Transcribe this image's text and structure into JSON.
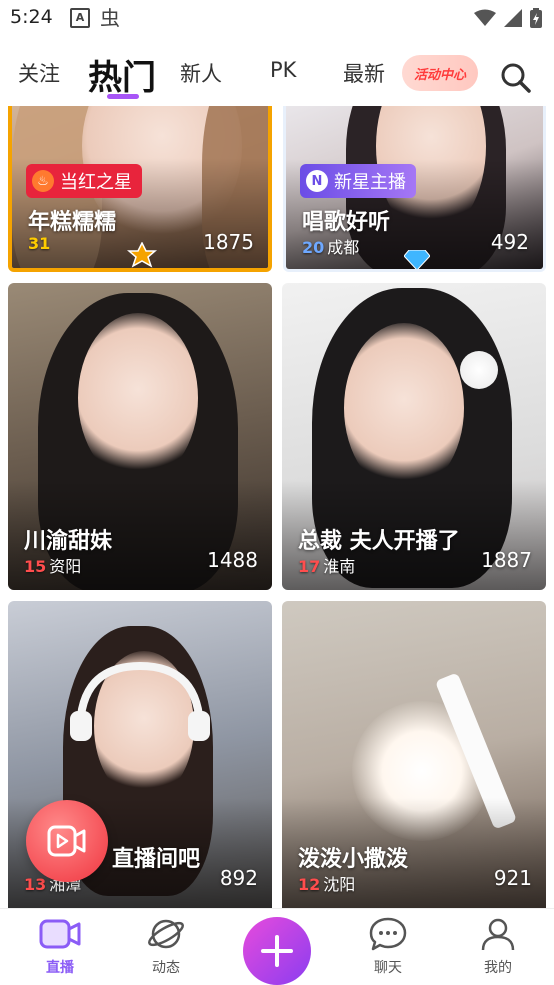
{
  "status_bar": {
    "time": "5:24",
    "icons": [
      "a-icon",
      "bug-icon",
      "wifi-icon",
      "signal-icon",
      "battery-icon"
    ]
  },
  "tabs": [
    {
      "label": "关注"
    },
    {
      "label": "热门",
      "active": true
    },
    {
      "label": "新人"
    },
    {
      "label": "PK"
    },
    {
      "label": "最新"
    }
  ],
  "activity_center": {
    "label": "活动中心"
  },
  "colors": {
    "accent": "#a855f7",
    "level_red": "#ff4d4d",
    "level_gold": "#ffcc00",
    "level_blue": "#6ea8ff",
    "badge_red": "#e8243c",
    "badge_purple": "#6b4de6"
  },
  "cards": [
    {
      "title": "年糕糯糯",
      "level": "31",
      "location": "",
      "viewers": "1875",
      "badge": "当红之星",
      "badge_icon": "flame-icon"
    },
    {
      "title": "唱歌好听",
      "level": "20",
      "location": "成都",
      "viewers": "492",
      "badge": "新星主播",
      "badge_icon": "n-icon"
    },
    {
      "title": "川渝甜妹",
      "level": "15",
      "location": "资阳",
      "viewers": "1488"
    },
    {
      "title": "总裁 夫人开播了",
      "level": "17",
      "location": "淮南",
      "viewers": "1887"
    },
    {
      "title": "直播间吧",
      "level": "13",
      "location": "湘潭",
      "viewers": "892"
    },
    {
      "title": "泼泼小撒泼",
      "level": "12",
      "location": "沈阳",
      "viewers": "921"
    }
  ],
  "bottom_nav": [
    {
      "label": "直播",
      "icon": "live-video-icon",
      "active": true
    },
    {
      "label": "动态",
      "icon": "planet-icon"
    },
    {
      "label": "",
      "icon": "plus-icon"
    },
    {
      "label": "聊天",
      "icon": "chat-bubble-icon"
    },
    {
      "label": "我的",
      "icon": "person-icon"
    }
  ]
}
